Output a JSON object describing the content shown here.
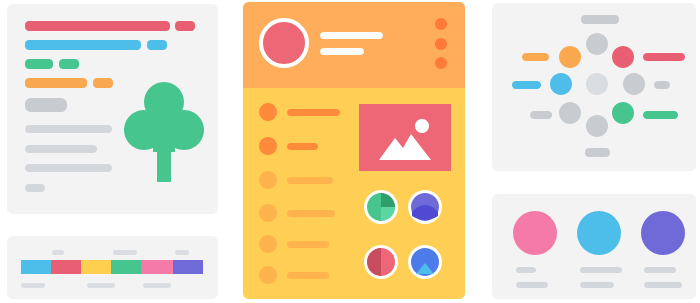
{
  "colors": {
    "panel": "#f3f3f4",
    "red": "#e85f73",
    "blue": "#4dbde9",
    "green": "#47c58f",
    "orange": "#f9a84f",
    "yellow": "#ffd04f",
    "pink": "#f47aa8",
    "purple": "#6f6ad8",
    "gray": "#c8cbd0",
    "light_gray": "#d9dce0",
    "card_orange": "#ffad5a",
    "card_yellow": "#ffce54",
    "profile_red": "#ee6777"
  },
  "icons": [
    "tree-icon",
    "image-icon",
    "pie-chart-icon",
    "avatar-icon",
    "menu-dots-icon"
  ]
}
